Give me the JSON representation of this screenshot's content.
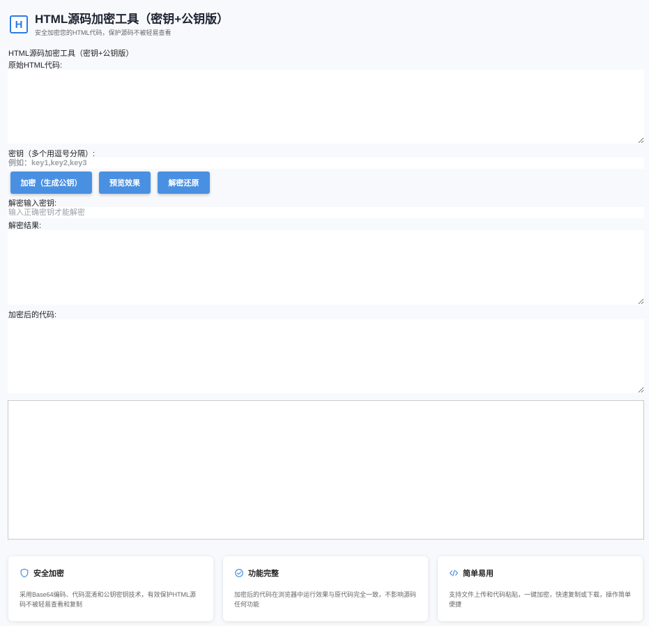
{
  "header": {
    "logo_text": "H",
    "title": "HTML源码加密工具（密钥+公钥版）",
    "subtitle": "安全加密您的HTML代码，保护源码不被轻易查看"
  },
  "section_title": "HTML源码加密工具（密钥+公钥版）",
  "source": {
    "label": "原始HTML代码:"
  },
  "keys": {
    "label": "密钥（多个用逗号分隔）:",
    "placeholder": "例如：key1,key2,key3"
  },
  "buttons": {
    "encrypt": "加密（生成公钥）",
    "preview": "预览效果",
    "decrypt": "解密还原"
  },
  "decrypt_key": {
    "label": "解密输入密钥:",
    "placeholder": "输入正确密钥才能解密"
  },
  "decrypt_result": {
    "label": "解密结果:"
  },
  "encrypted": {
    "label": "加密后的代码:"
  },
  "features": [
    {
      "icon": "shield-icon",
      "title": "安全加密",
      "desc": "采用Base64编码、代码混淆和公钥密钥技术，有效保护HTML源码不被轻易查看和复制"
    },
    {
      "icon": "check-circle-icon",
      "title": "功能完整",
      "desc": "加密后的代码在浏览器中运行效果与原代码完全一致，不影响源码任何功能"
    },
    {
      "icon": "code-icon",
      "title": "简单易用",
      "desc": "支持文件上传和代码粘贴，一键加密，快速复制或下载，操作简单便捷"
    }
  ],
  "colors": {
    "accent": "#4a90e2",
    "background": "#f7f9fc"
  }
}
